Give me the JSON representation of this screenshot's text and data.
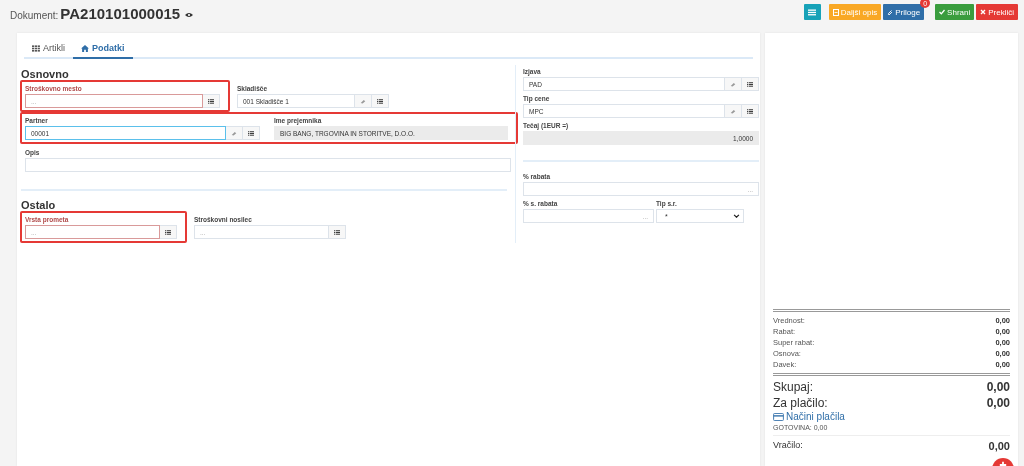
{
  "header": {
    "label": "Dokument:",
    "number": "PA210101000015"
  },
  "toolbar": [
    {
      "kind": "list",
      "color": "#17a2b8"
    },
    {
      "kind": "notes",
      "label": "Daljši opis",
      "color": "#f9a825"
    },
    {
      "kind": "attach",
      "label": "Priloge",
      "color": "#2f6ea8",
      "badge": "0"
    },
    {
      "kind": "save",
      "label": "Shrani",
      "color": "#3a9d3e"
    },
    {
      "kind": "cancel",
      "label": "Prekliči",
      "color": "#e53935"
    }
  ],
  "tabs": [
    {
      "label": "Artikli",
      "selected": false
    },
    {
      "label": "Podatki",
      "selected": true
    }
  ],
  "left_sections": [
    {
      "title": "Osnovno",
      "rows": [
        {
          "groups": [
            {
              "highlighted": true,
              "fields": [
                {
                  "kind": "lookup",
                  "label": "Stroškovno mesto",
                  "placeholder": "...",
                  "required": true
                }
              ]
            },
            {
              "highlighted": false,
              "fields": [
                {
                  "kind": "lookup_clear",
                  "label": "Skladišče",
                  "value": "001 Skladišče 1"
                }
              ]
            }
          ]
        },
        {
          "groups": [
            {
              "highlighted": true,
              "fields": [
                {
                  "kind": "lookup_clear",
                  "label": "Partner",
                  "value": "00001",
                  "focused": true
                },
                {
                  "kind": "readonly",
                  "label": "Ime prejemnika",
                  "value": "BIG BANG, TRGOVINA IN STORITVE, D.O.O."
                }
              ]
            }
          ]
        },
        {
          "groups": [
            {
              "highlighted": false,
              "fields": [
                {
                  "kind": "plain",
                  "label": "Opis"
                }
              ]
            }
          ]
        }
      ]
    },
    {
      "title": "Ostalo",
      "rows": [
        {
          "groups": [
            {
              "highlighted": true,
              "fields": [
                {
                  "kind": "lookup",
                  "label": "Vrsta prometa",
                  "placeholder": "...",
                  "required": true
                }
              ]
            },
            {
              "highlighted": false,
              "fields": [
                {
                  "kind": "lookup",
                  "label": "Stroškovni nosilec",
                  "placeholder": "..."
                }
              ]
            }
          ]
        }
      ]
    }
  ],
  "right_sections": [
    {
      "rows": [
        {
          "fields": [
            {
              "kind": "lookup_clear",
              "label": "Izjava",
              "value": "PAD"
            }
          ]
        },
        {
          "fields": [
            {
              "kind": "lookup_clear",
              "label": "Tip cene",
              "value": "MPC"
            }
          ]
        },
        {
          "fields": [
            {
              "kind": "readonly_number",
              "label": "Tečaj (1EUR =)",
              "value": "1,0000"
            }
          ]
        }
      ]
    },
    {
      "rows": [
        {
          "fields": [
            {
              "kind": "number",
              "label": "% rabata",
              "placeholder": "..."
            }
          ]
        },
        {
          "fields": [
            {
              "kind": "number",
              "label": "% s. rabata",
              "placeholder": "..."
            },
            {
              "kind": "select",
              "label": "Tip s.r.",
              "value": "*"
            }
          ]
        }
      ]
    }
  ],
  "summary": {
    "lines": [
      {
        "label": "Vrednost:",
        "value": "0,00"
      },
      {
        "label": "Rabat:",
        "value": "0,00"
      },
      {
        "label": "Super rabat:",
        "value": "0,00"
      },
      {
        "label": "Osnova:",
        "value": "0,00"
      },
      {
        "label": "Davek:",
        "value": "0,00"
      }
    ],
    "totals": [
      {
        "label": "Skupaj:",
        "value": "0,00"
      },
      {
        "label": "Za plačilo:",
        "value": "0,00"
      }
    ],
    "payment_link": "Načini plačila",
    "payment_note": "GOTOVINA: 0,00",
    "change": {
      "label": "Vračilo:",
      "value": "0,00"
    }
  }
}
